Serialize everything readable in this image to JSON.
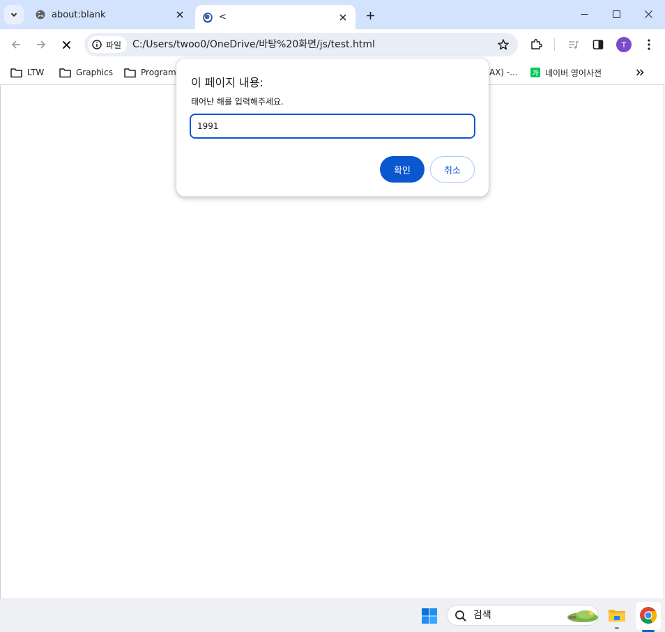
{
  "tabs": [
    {
      "title": "about:blank",
      "favicon": "globe-icon"
    },
    {
      "title": "<",
      "favicon": "loading-icon",
      "active": true
    }
  ],
  "window_controls": [
    "minimize-icon",
    "maximize-icon",
    "close-icon"
  ],
  "toolbar": {
    "security_chip": "파일",
    "url": "C:/Users/twoo0/OneDrive/바탕%20화면/js/test.html",
    "profile_initial": "T"
  },
  "bookmarks": [
    {
      "label": "LTW",
      "icon": "folder-icon"
    },
    {
      "label": "Graphics",
      "icon": "folder-icon"
    },
    {
      "label": "Programm",
      "icon": "folder-icon"
    },
    {
      "label": "AX) -...",
      "icon": "none"
    },
    {
      "label": "네이버 영어사전",
      "icon": "naver-icon"
    }
  ],
  "dialog": {
    "title": "이 페이지 내용:",
    "message": "태어난 해를 입력해주세요.",
    "input_value": "1991",
    "ok_label": "확인",
    "cancel_label": "취소"
  },
  "taskbar": {
    "search_label": "검색",
    "apps": [
      "windows-start-icon",
      "file-explorer-icon",
      "chrome-icon"
    ]
  },
  "colors": {
    "tabstrip": "#d3e3fd",
    "accent": "#0b57d0",
    "omnibox": "#e9eef6"
  }
}
